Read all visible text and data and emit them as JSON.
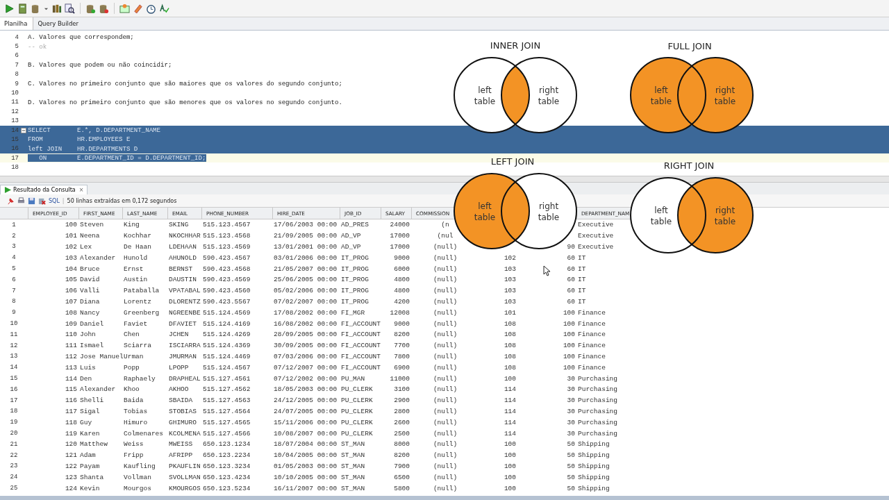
{
  "editor_tabs": [
    {
      "label": "Planilha",
      "selected": true
    },
    {
      "label": "Query Builder",
      "selected": false
    }
  ],
  "editor_lines": [
    {
      "number": "4",
      "text": "A. Valores que correspondem;",
      "kind": "plain",
      "selected": false,
      "current": false
    },
    {
      "number": "5",
      "text": "-- ok",
      "kind": "comment",
      "selected": false,
      "current": false
    },
    {
      "number": "6",
      "selected": false,
      "current": false
    },
    {
      "number": "7",
      "text": "B. Valores que podem ou não coincidir;",
      "kind": "plain",
      "selected": false,
      "current": false
    },
    {
      "number": "8",
      "selected": false,
      "current": false
    },
    {
      "number": "9",
      "text": "C. Valores no primeiro conjunto que são maiores que os valores do segundo conjunto;",
      "kind": "plain",
      "selected": false,
      "current": false
    },
    {
      "number": "10",
      "selected": false,
      "current": false
    },
    {
      "number": "11",
      "text": "D. Valores no primeiro conjunto que são menores que os valores no segundo conjunto.",
      "kind": "plain",
      "selected": false,
      "current": false
    },
    {
      "number": "12",
      "selected": false,
      "current": false
    },
    {
      "number": "13",
      "selected": false,
      "current": false
    },
    {
      "number": "14",
      "text": "SELECT       E.*, D.DEPARTMENT_NAME",
      "kind": "plain",
      "selected": true,
      "current": false,
      "foldable": true
    },
    {
      "number": "15",
      "text": "FROM         HR.EMPLOYEES E",
      "kind": "plain",
      "selected": true,
      "current": false
    },
    {
      "number": "16",
      "text": "left JOIN    HR.DEPARTMENTS D",
      "kind": "plain",
      "selected": true,
      "current": false
    },
    {
      "number": "17",
      "text": "   ON        E.DEPARTMENT_ID = D.DEPARTMENT_ID;",
      "kind": "plain",
      "selected": true,
      "current": true
    },
    {
      "number": "18",
      "selected": false,
      "current": false
    }
  ],
  "result_tab": {
    "label": "Resultado da Consulta",
    "close": "×"
  },
  "result_toolbar": {
    "sql_link": "SQL",
    "separator": "|",
    "status": "50 linhas extraídas em 0,172 segundos"
  },
  "table": {
    "columns": [
      "EMPLOYEE_ID",
      "FIRST_NAME",
      "LAST_NAME",
      "EMAIL",
      "PHONE_NUMBER",
      "HIRE_DATE",
      "JOB_ID",
      "SALARY",
      "COMMISSION",
      null,
      null,
      "DEPARTMENT_NAM"
    ],
    "rows": [
      {
        "n": "1",
        "cells": [
          "100",
          "Steven",
          "King",
          "SKING",
          "515.123.4567",
          "17/06/2003 00:00",
          "AD_PRES",
          "24000",
          "(n",
          null,
          null,
          "Executive"
        ]
      },
      {
        "n": "2",
        "cells": [
          "101",
          "Neena",
          "Kochhar",
          "NKOCHHAR",
          "515.123.4568",
          "21/09/2005 00:00",
          "AD_VP",
          "17000",
          "(nul",
          null,
          null,
          "Executive"
        ]
      },
      {
        "n": "3",
        "cells": [
          "102",
          "Lex",
          "De Haan",
          "LDEHAAN",
          "515.123.4569",
          "13/01/2001 00:00",
          "AD_VP",
          "17000",
          "(null)",
          null,
          "90",
          "Executive"
        ]
      },
      {
        "n": "4",
        "cells": [
          "103",
          "Alexander",
          "Hunold",
          "AHUNOLD",
          "590.423.4567",
          "03/01/2006 00:00",
          "IT_PROG",
          "9000",
          "(null)",
          "102",
          "60",
          "IT"
        ]
      },
      {
        "n": "5",
        "cells": [
          "104",
          "Bruce",
          "Ernst",
          "BERNST",
          "590.423.4568",
          "21/05/2007 00:00",
          "IT_PROG",
          "6000",
          "(null)",
          "103",
          "60",
          "IT"
        ]
      },
      {
        "n": "6",
        "cells": [
          "105",
          "David",
          "Austin",
          "DAUSTIN",
          "590.423.4569",
          "25/06/2005 00:00",
          "IT_PROG",
          "4800",
          "(null)",
          "103",
          "60",
          "IT"
        ]
      },
      {
        "n": "7",
        "cells": [
          "106",
          "Valli",
          "Pataballa",
          "VPATABAL",
          "590.423.4560",
          "05/02/2006 00:00",
          "IT_PROG",
          "4800",
          "(null)",
          "103",
          "60",
          "IT"
        ]
      },
      {
        "n": "8",
        "cells": [
          "107",
          "Diana",
          "Lorentz",
          "DLORENTZ",
          "590.423.5567",
          "07/02/2007 00:00",
          "IT_PROG",
          "4200",
          "(null)",
          "103",
          "60",
          "IT"
        ]
      },
      {
        "n": "9",
        "cells": [
          "108",
          "Nancy",
          "Greenberg",
          "NGREENBE",
          "515.124.4569",
          "17/08/2002 00:00",
          "FI_MGR",
          "12008",
          "(null)",
          "101",
          "100",
          "Finance"
        ]
      },
      {
        "n": "10",
        "cells": [
          "109",
          "Daniel",
          "Faviet",
          "DFAVIET",
          "515.124.4169",
          "16/08/2002 00:00",
          "FI_ACCOUNT",
          "9000",
          "(null)",
          "108",
          "100",
          "Finance"
        ]
      },
      {
        "n": "11",
        "cells": [
          "110",
          "John",
          "Chen",
          "JCHEN",
          "515.124.4269",
          "28/09/2005 00:00",
          "FI_ACCOUNT",
          "8200",
          "(null)",
          "108",
          "100",
          "Finance"
        ]
      },
      {
        "n": "12",
        "cells": [
          "111",
          "Ismael",
          "Sciarra",
          "ISCIARRA",
          "515.124.4369",
          "30/09/2005 00:00",
          "FI_ACCOUNT",
          "7700",
          "(null)",
          "108",
          "100",
          "Finance"
        ]
      },
      {
        "n": "13",
        "cells": [
          "112",
          "Jose Manuel",
          "Urman",
          "JMURMAN",
          "515.124.4469",
          "07/03/2006 00:00",
          "FI_ACCOUNT",
          "7800",
          "(null)",
          "108",
          "100",
          "Finance"
        ]
      },
      {
        "n": "14",
        "cells": [
          "113",
          "Luis",
          "Popp",
          "LPOPP",
          "515.124.4567",
          "07/12/2007 00:00",
          "FI_ACCOUNT",
          "6900",
          "(null)",
          "108",
          "100",
          "Finance"
        ]
      },
      {
        "n": "15",
        "cells": [
          "114",
          "Den",
          "Raphaely",
          "DRAPHEAL",
          "515.127.4561",
          "07/12/2002 00:00",
          "PU_MAN",
          "11000",
          "(null)",
          "100",
          "30",
          "Purchasing"
        ]
      },
      {
        "n": "16",
        "cells": [
          "115",
          "Alexander",
          "Khoo",
          "AKHOO",
          "515.127.4562",
          "18/05/2003 00:00",
          "PU_CLERK",
          "3100",
          "(null)",
          "114",
          "30",
          "Purchasing"
        ]
      },
      {
        "n": "17",
        "cells": [
          "116",
          "Shelli",
          "Baida",
          "SBAIDA",
          "515.127.4563",
          "24/12/2005 00:00",
          "PU_CLERK",
          "2900",
          "(null)",
          "114",
          "30",
          "Purchasing"
        ]
      },
      {
        "n": "18",
        "cells": [
          "117",
          "Sigal",
          "Tobias",
          "STOBIAS",
          "515.127.4564",
          "24/07/2005 00:00",
          "PU_CLERK",
          "2800",
          "(null)",
          "114",
          "30",
          "Purchasing"
        ]
      },
      {
        "n": "19",
        "cells": [
          "118",
          "Guy",
          "Himuro",
          "GHIMURO",
          "515.127.4565",
          "15/11/2006 00:00",
          "PU_CLERK",
          "2600",
          "(null)",
          "114",
          "30",
          "Purchasing"
        ]
      },
      {
        "n": "20",
        "cells": [
          "119",
          "Karen",
          "Colmenares",
          "KCOLMENA",
          "515.127.4566",
          "10/08/2007 00:00",
          "PU_CLERK",
          "2500",
          "(null)",
          "114",
          "30",
          "Purchasing"
        ]
      },
      {
        "n": "21",
        "cells": [
          "120",
          "Matthew",
          "Weiss",
          "MWEISS",
          "650.123.1234",
          "18/07/2004 00:00",
          "ST_MAN",
          "8000",
          "(null)",
          "100",
          "50",
          "Shipping"
        ]
      },
      {
        "n": "22",
        "cells": [
          "121",
          "Adam",
          "Fripp",
          "AFRIPP",
          "650.123.2234",
          "10/04/2005 00:00",
          "ST_MAN",
          "8200",
          "(null)",
          "100",
          "50",
          "Shipping"
        ]
      },
      {
        "n": "23",
        "cells": [
          "122",
          "Payam",
          "Kaufling",
          "PKAUFLIN",
          "650.123.3234",
          "01/05/2003 00:00",
          "ST_MAN",
          "7900",
          "(null)",
          "100",
          "50",
          "Shipping"
        ]
      },
      {
        "n": "24",
        "cells": [
          "123",
          "Shanta",
          "Vollman",
          "SVOLLMAN",
          "650.123.4234",
          "10/10/2005 00:00",
          "ST_MAN",
          "6500",
          "(null)",
          "100",
          "50",
          "Shipping"
        ]
      },
      {
        "n": "25",
        "cells": [
          "124",
          "Kevin",
          "Mourgos",
          "KMOURGOS",
          "650.123.5234",
          "16/11/2007 00:00",
          "ST_MAN",
          "5800",
          "(null)",
          "100",
          "50",
          "Shipping"
        ]
      }
    ]
  },
  "join_diagrams": [
    {
      "title": "INNER JOIN",
      "kind": "inner",
      "left_label": "left table",
      "right_label": "right table"
    },
    {
      "title": "FULL JOIN",
      "kind": "full",
      "left_label": "left table",
      "right_label": "right table"
    },
    {
      "title": "LEFT JOIN",
      "kind": "left",
      "left_label": "left table",
      "right_label": "right table"
    },
    {
      "title": "RIGHT JOIN",
      "kind": "right",
      "left_label": "left table",
      "right_label": "right table"
    }
  ]
}
